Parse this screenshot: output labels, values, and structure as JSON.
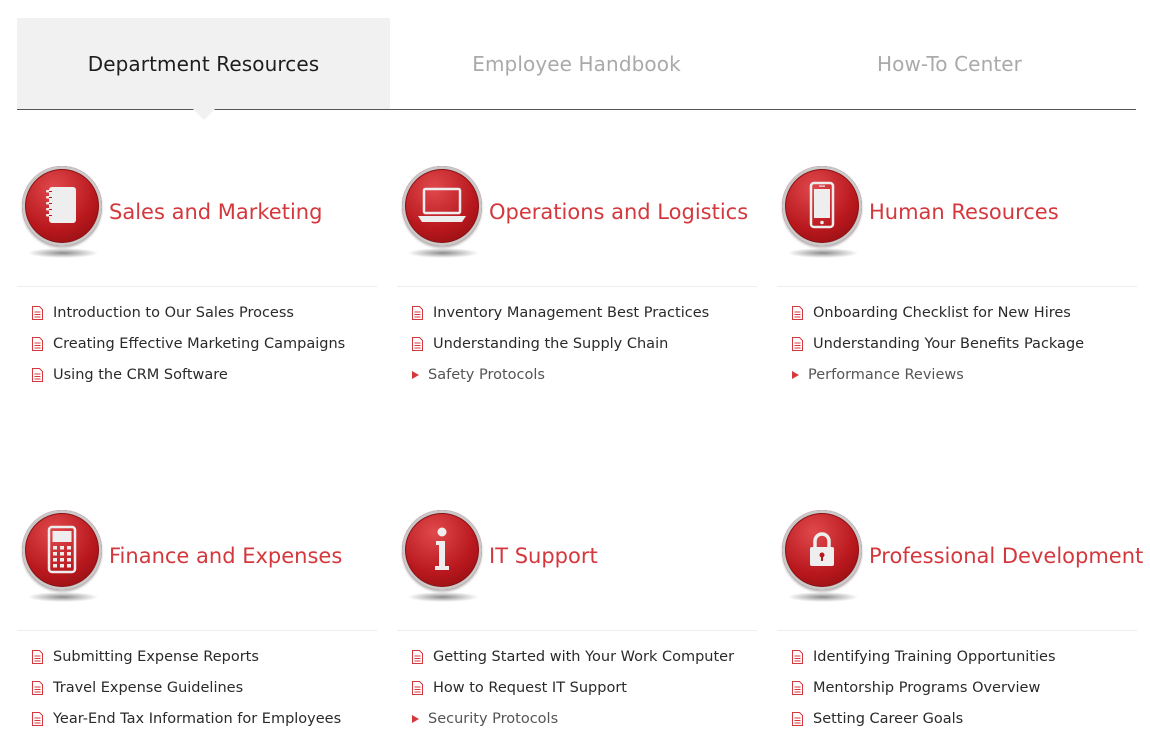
{
  "tabs": [
    {
      "label": "Department Resources",
      "active": true
    },
    {
      "label": "Employee Handbook",
      "active": false
    },
    {
      "label": "How-To Center",
      "active": false
    }
  ],
  "colors": {
    "accent": "#d4383d",
    "icon_red": "#b8181d",
    "tab_active_bg": "#f1f1f1"
  },
  "sections": [
    {
      "title": "Sales and Marketing",
      "icon": "notebook-icon",
      "items": [
        {
          "label": "Introduction to Our Sales Process",
          "type": "document"
        },
        {
          "label": "Creating Effective Marketing Campaigns",
          "type": "document"
        },
        {
          "label": "Using the CRM Software",
          "type": "document"
        }
      ]
    },
    {
      "title": "Operations and Logistics",
      "icon": "laptop-icon",
      "items": [
        {
          "label": "Inventory Management Best Practices",
          "type": "document"
        },
        {
          "label": "Understanding the Supply Chain",
          "type": "document"
        },
        {
          "label": "Safety Protocols",
          "type": "folder"
        }
      ]
    },
    {
      "title": "Human Resources",
      "icon": "smartphone-icon",
      "items": [
        {
          "label": "Onboarding Checklist for New Hires",
          "type": "document"
        },
        {
          "label": "Understanding Your Benefits Package",
          "type": "document"
        },
        {
          "label": "Performance Reviews",
          "type": "folder"
        }
      ]
    },
    {
      "title": "Finance and Expenses",
      "icon": "calculator-icon",
      "items": [
        {
          "label": "Submitting Expense Reports",
          "type": "document"
        },
        {
          "label": "Travel Expense Guidelines",
          "type": "document"
        },
        {
          "label": "Year-End Tax Information for Employees",
          "type": "document"
        }
      ]
    },
    {
      "title": "IT Support",
      "icon": "info-icon",
      "items": [
        {
          "label": "Getting Started with Your Work Computer",
          "type": "document"
        },
        {
          "label": "How to Request IT Support",
          "type": "document"
        },
        {
          "label": "Security Protocols",
          "type": "folder"
        }
      ]
    },
    {
      "title": "Professional Development",
      "icon": "lock-icon",
      "items": [
        {
          "label": "Identifying Training Opportunities",
          "type": "document"
        },
        {
          "label": "Mentorship Programs Overview",
          "type": "document"
        },
        {
          "label": "Setting Career Goals",
          "type": "document"
        }
      ]
    }
  ]
}
